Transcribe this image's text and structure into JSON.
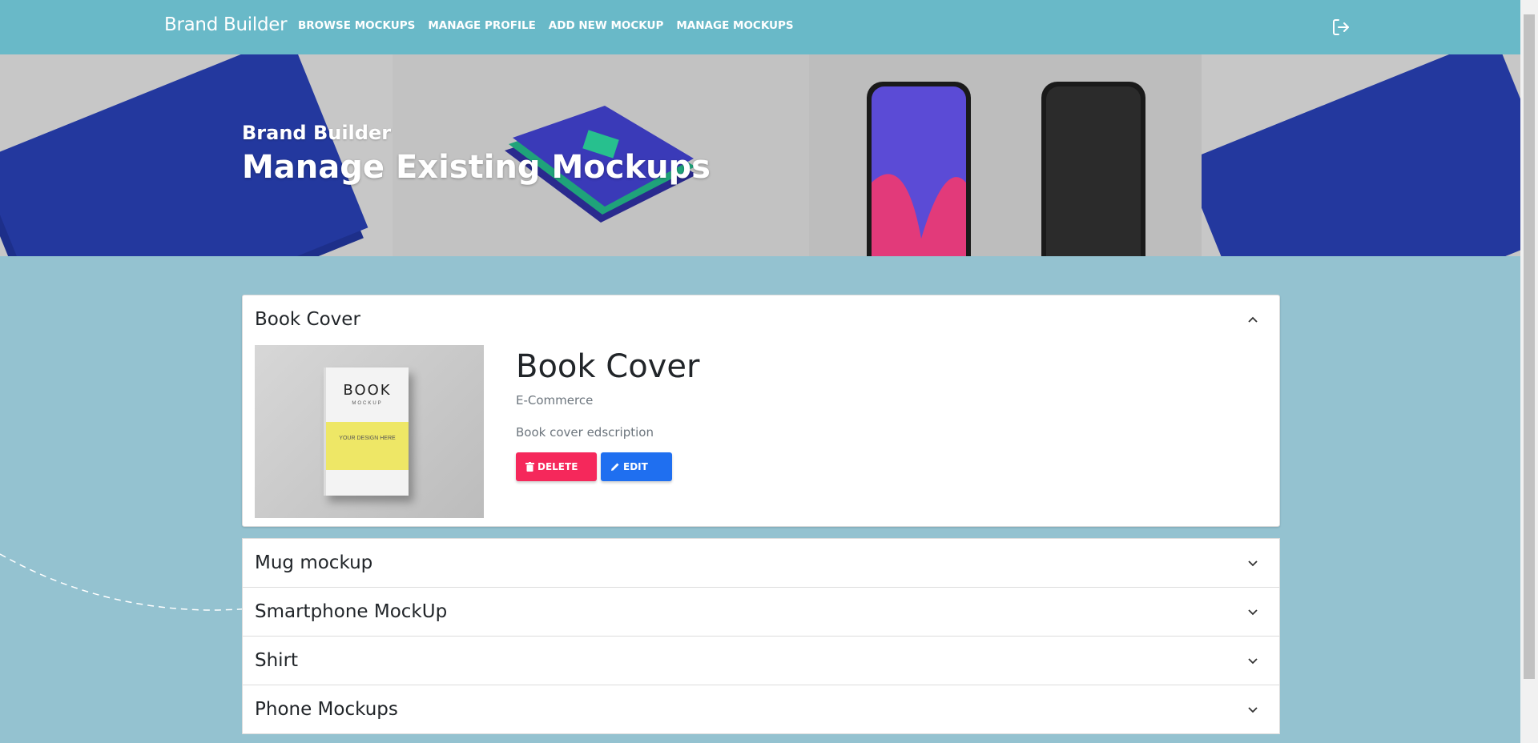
{
  "navbar": {
    "brand": "Brand Builder",
    "links": [
      "BROWSE MOCKUPS",
      "MANAGE PROFILE",
      "ADD NEW MOCKUP",
      "MANAGE MOCKUPS"
    ],
    "logout_icon": "logout-icon"
  },
  "hero": {
    "subtitle": "Brand Builder",
    "title": "Manage Existing Mockups"
  },
  "accordion": {
    "open_item": {
      "title": "Book Cover",
      "detail_title": "Book Cover",
      "category": "E-Commerce",
      "description": "Book cover edscription",
      "delete_label": "DELETE",
      "edit_label": "EDIT",
      "thumb": {
        "title": "BOOK",
        "subtitle": "MOCKUP",
        "text": "YOUR DESIGN HERE"
      }
    },
    "closed_items": [
      "Mug mockup",
      "Smartphone MockUp",
      "Shirt",
      "Phone Mockups"
    ]
  },
  "colors": {
    "navbar": "#69b9c8",
    "background": "#94c2d0",
    "delete": "#f5285b",
    "edit": "#1f6ff0"
  }
}
